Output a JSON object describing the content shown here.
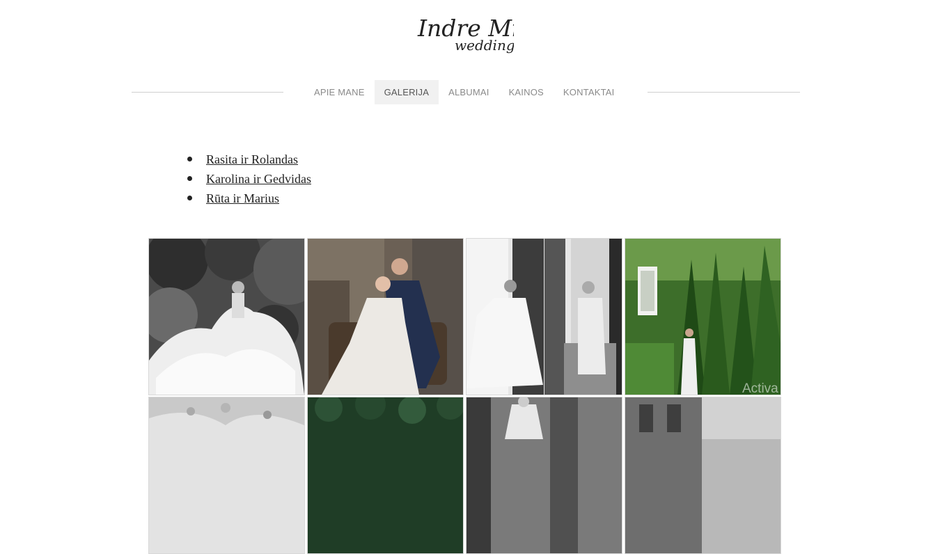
{
  "logo": {
    "line1": "Indre Mi",
    "line2": "wedding"
  },
  "nav": [
    {
      "label": "APIE MANE",
      "active": false
    },
    {
      "label": "GALERIJA",
      "active": true
    },
    {
      "label": "ALBUMAI",
      "active": false
    },
    {
      "label": "KAINOS",
      "active": false
    },
    {
      "label": "KONTAKTAI",
      "active": false
    }
  ],
  "albums": [
    {
      "label": "Rasita ir Rolandas"
    },
    {
      "label": "Karolina ir Gedvidas"
    },
    {
      "label": "Rūta ir Marius"
    }
  ],
  "gallery": [
    {
      "name": "bride-twirling-dress-bw-photo"
    },
    {
      "name": "couple-seated-in-chair-photo"
    },
    {
      "name": "bride-by-window-bw-photo"
    },
    {
      "name": "bride-in-garden-photo"
    },
    {
      "name": "lace-dress-detail-photo"
    },
    {
      "name": "ivy-wall-photo"
    },
    {
      "name": "bride-interior-bw-photo"
    },
    {
      "name": "building-exterior-bw-photo"
    }
  ],
  "watermark": "Activa"
}
